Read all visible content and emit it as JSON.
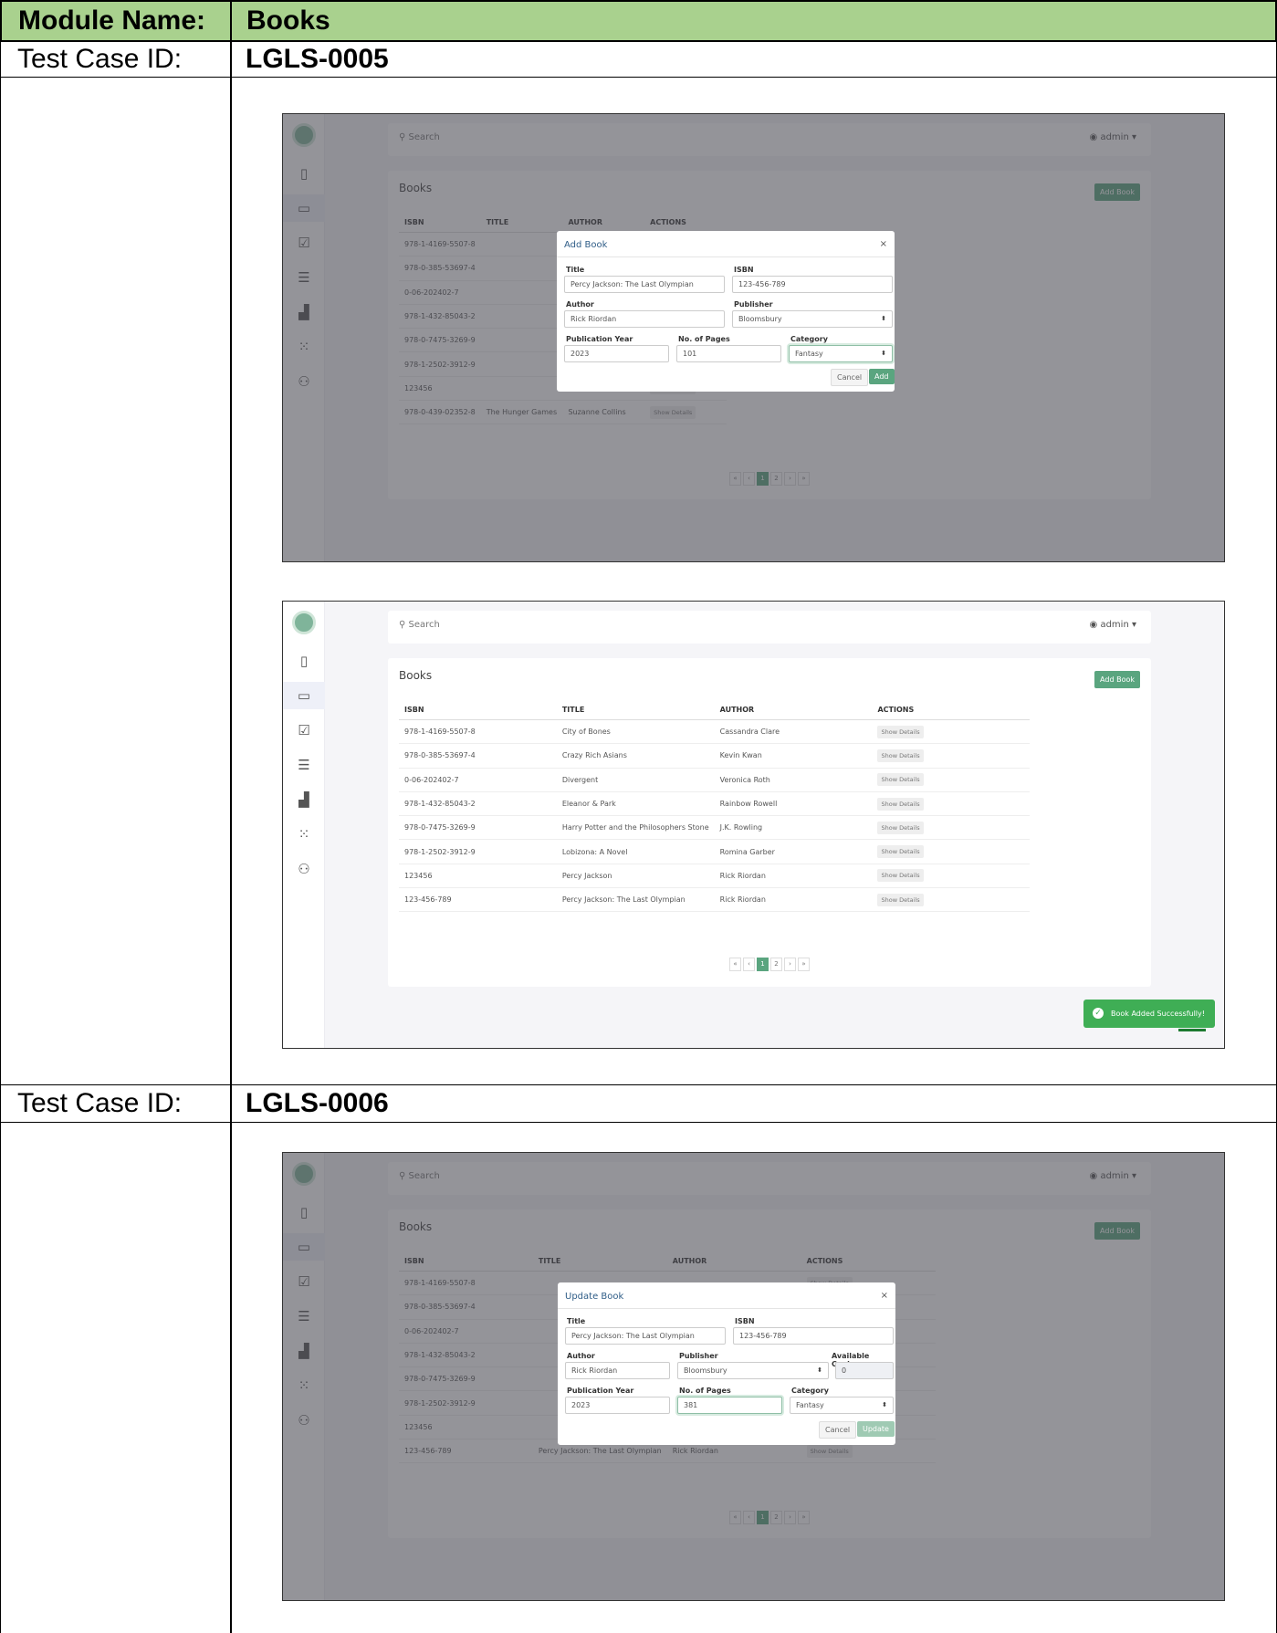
{
  "header": {
    "module_label": "Module Name:",
    "module_value": "Books"
  },
  "test_cases": [
    {
      "label": "Test Case ID:",
      "id": "LGLS-0005"
    },
    {
      "label": "Test Case ID:",
      "id": "LGLS-0006"
    }
  ],
  "app": {
    "search_placeholder": "Search",
    "user": "admin",
    "books_title": "Books",
    "add_book_button": "Add Book",
    "columns": [
      "ISBN",
      "TITLE",
      "AUTHOR",
      "ACTIONS"
    ],
    "show_details": "Show Details",
    "pager": [
      "«",
      "‹",
      "1",
      "2",
      "›",
      "»"
    ]
  },
  "shot1": {
    "rows": [
      {
        "isbn": "978-1-4169-5507-8",
        "title": "",
        "author": ""
      },
      {
        "isbn": "978-0-385-53697-4",
        "title": "",
        "author": ""
      },
      {
        "isbn": "0-06-202402-7",
        "title": "",
        "author": ""
      },
      {
        "isbn": "978-1-432-85043-2",
        "title": "",
        "author": ""
      },
      {
        "isbn": "978-0-7475-3269-9",
        "title": "",
        "author": ""
      },
      {
        "isbn": "978-1-2502-3912-9",
        "title": "",
        "author": ""
      },
      {
        "isbn": "123456",
        "title": "",
        "author": ""
      },
      {
        "isbn": "978-0-439-02352-8",
        "title": "The Hunger Games",
        "author": "Suzanne Collins"
      }
    ],
    "modal": {
      "title": "Add Book",
      "close": "×",
      "title_label": "Title",
      "title_value": "Percy Jackson: The Last Olympian",
      "isbn_label": "ISBN",
      "isbn_value": "123-456-789",
      "author_label": "Author",
      "author_value": "Rick Riordan",
      "publisher_label": "Publisher",
      "publisher_value": "Bloomsbury",
      "year_label": "Publication Year",
      "year_value": "2023",
      "pages_label": "No. of Pages",
      "pages_value": "101",
      "category_label": "Category",
      "category_value": "Fantasy",
      "cancel": "Cancel",
      "ok": "Add"
    }
  },
  "shot2": {
    "rows": [
      {
        "isbn": "978-1-4169-5507-8",
        "title": "City of Bones",
        "author": "Cassandra Clare"
      },
      {
        "isbn": "978-0-385-53697-4",
        "title": "Crazy Rich Asians",
        "author": "Kevin Kwan"
      },
      {
        "isbn": "0-06-202402-7",
        "title": "Divergent",
        "author": "Veronica Roth"
      },
      {
        "isbn": "978-1-432-85043-2",
        "title": "Eleanor & Park",
        "author": "Rainbow Rowell"
      },
      {
        "isbn": "978-0-7475-3269-9",
        "title": "Harry Potter and the Philosophers Stone",
        "author": "J.K. Rowling"
      },
      {
        "isbn": "978-1-2502-3912-9",
        "title": "Lobizona: A Novel",
        "author": "Romina Garber"
      },
      {
        "isbn": "123456",
        "title": "Percy Jackson",
        "author": "Rick Riordan"
      },
      {
        "isbn": "123-456-789",
        "title": "Percy Jackson: The Last Olympian",
        "author": "Rick Riordan"
      }
    ],
    "toast": "Book Added Successfully!"
  },
  "shot3": {
    "rows": [
      {
        "isbn": "978-1-4169-5507-8",
        "title": "",
        "author": ""
      },
      {
        "isbn": "978-0-385-53697-4",
        "title": "",
        "author": ""
      },
      {
        "isbn": "0-06-202402-7",
        "title": "",
        "author": ""
      },
      {
        "isbn": "978-1-432-85043-2",
        "title": "",
        "author": ""
      },
      {
        "isbn": "978-0-7475-3269-9",
        "title": "",
        "author": ""
      },
      {
        "isbn": "978-1-2502-3912-9",
        "title": "",
        "author": ""
      },
      {
        "isbn": "123456",
        "title": "",
        "author": ""
      },
      {
        "isbn": "123-456-789",
        "title": "Percy Jackson: The Last Olympian",
        "author": "Rick Riordan"
      }
    ],
    "modal": {
      "title": "Update Book",
      "close": "×",
      "title_label": "Title",
      "title_value": "Percy Jackson: The Last Olympian",
      "isbn_label": "ISBN",
      "isbn_value": "123-456-789",
      "author_label": "Author",
      "author_value": "Rick Riordan",
      "publisher_label": "Publisher",
      "publisher_value": "Bloomsbury",
      "copies_label": "Available Copies",
      "copies_value": "0",
      "year_label": "Publication Year",
      "year_value": "2023",
      "pages_label": "No. of Pages",
      "pages_value": "381",
      "category_label": "Category",
      "category_value": "Fantasy",
      "cancel": "Cancel",
      "ok": "Update"
    }
  },
  "colors": {
    "header_bg": "#a9d18e",
    "accent": "#5aa57f",
    "toast": "#3fae55"
  }
}
